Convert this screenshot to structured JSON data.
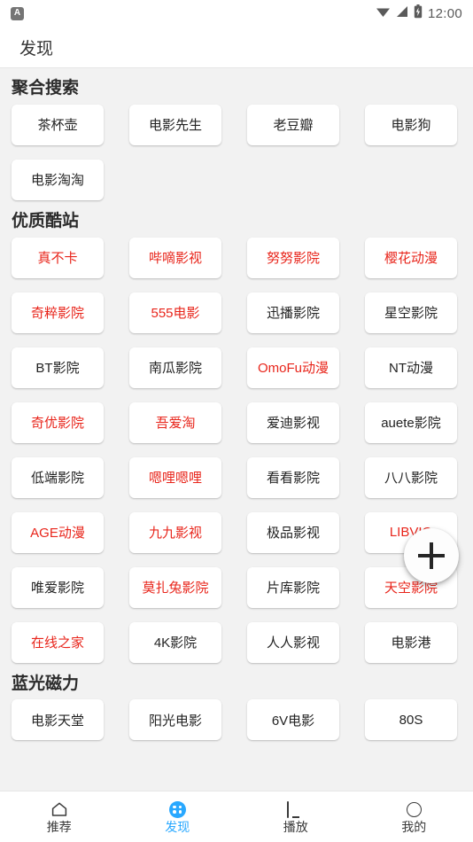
{
  "status_bar": {
    "app_badge_letter": "A",
    "icons": [
      "wifi-icon",
      "signal-icon",
      "battery-charging-icon"
    ],
    "time": "12:00"
  },
  "header": {
    "title": "发现"
  },
  "fab": {
    "icon": "plus-icon",
    "label": "+"
  },
  "sections": [
    {
      "title": "聚合搜索",
      "items": [
        {
          "label": "茶杯壶",
          "highlight": false
        },
        {
          "label": "电影先生",
          "highlight": false
        },
        {
          "label": "老豆瓣",
          "highlight": false
        },
        {
          "label": "电影狗",
          "highlight": false
        },
        {
          "label": "电影淘淘",
          "highlight": false
        }
      ]
    },
    {
      "title": "优质酷站",
      "items": [
        {
          "label": "真不卡",
          "highlight": true
        },
        {
          "label": "哔嘀影视",
          "highlight": true
        },
        {
          "label": "努努影院",
          "highlight": true
        },
        {
          "label": "樱花动漫",
          "highlight": true
        },
        {
          "label": "奇粹影院",
          "highlight": true
        },
        {
          "label": "555电影",
          "highlight": true
        },
        {
          "label": "迅播影院",
          "highlight": false
        },
        {
          "label": "星空影院",
          "highlight": false
        },
        {
          "label": "BT影院",
          "highlight": false
        },
        {
          "label": "南瓜影院",
          "highlight": false
        },
        {
          "label": "OmoFu动漫",
          "highlight": true
        },
        {
          "label": "NT动漫",
          "highlight": false
        },
        {
          "label": "奇优影院",
          "highlight": true
        },
        {
          "label": "吾爱淘",
          "highlight": true
        },
        {
          "label": "爱迪影视",
          "highlight": false
        },
        {
          "label": "auete影院",
          "highlight": false
        },
        {
          "label": "低端影院",
          "highlight": false
        },
        {
          "label": "嗯哩嗯哩",
          "highlight": true
        },
        {
          "label": "看看影院",
          "highlight": false
        },
        {
          "label": "八八影院",
          "highlight": false
        },
        {
          "label": "AGE动漫",
          "highlight": true
        },
        {
          "label": "九九影视",
          "highlight": true
        },
        {
          "label": "极品影视",
          "highlight": false
        },
        {
          "label": "LIBVIO",
          "highlight": true
        },
        {
          "label": "唯爱影院",
          "highlight": false
        },
        {
          "label": "莫扎兔影院",
          "highlight": true
        },
        {
          "label": "片库影院",
          "highlight": false
        },
        {
          "label": "天空影院",
          "highlight": true
        },
        {
          "label": "在线之家",
          "highlight": true
        },
        {
          "label": "4K影院",
          "highlight": false
        },
        {
          "label": "人人影视",
          "highlight": false
        },
        {
          "label": "电影港",
          "highlight": false
        }
      ]
    },
    {
      "title": "蓝光磁力",
      "items": [
        {
          "label": "电影天堂",
          "highlight": false
        },
        {
          "label": "阳光电影",
          "highlight": false
        },
        {
          "label": "6V电影",
          "highlight": false
        },
        {
          "label": "80S",
          "highlight": false
        }
      ]
    }
  ],
  "bottom_nav": {
    "active_index": 1,
    "items": [
      {
        "label": "推荐",
        "icon": "home-icon"
      },
      {
        "label": "发现",
        "icon": "discover-grid-icon"
      },
      {
        "label": "播放",
        "icon": "monitor-icon"
      },
      {
        "label": "我的",
        "icon": "profile-circle-icon"
      }
    ]
  },
  "colors": {
    "highlight": "#e8251b",
    "accent": "#29a8ff",
    "page_background": "#f2f2f2",
    "card_background": "#ffffff",
    "text": "#232323"
  }
}
